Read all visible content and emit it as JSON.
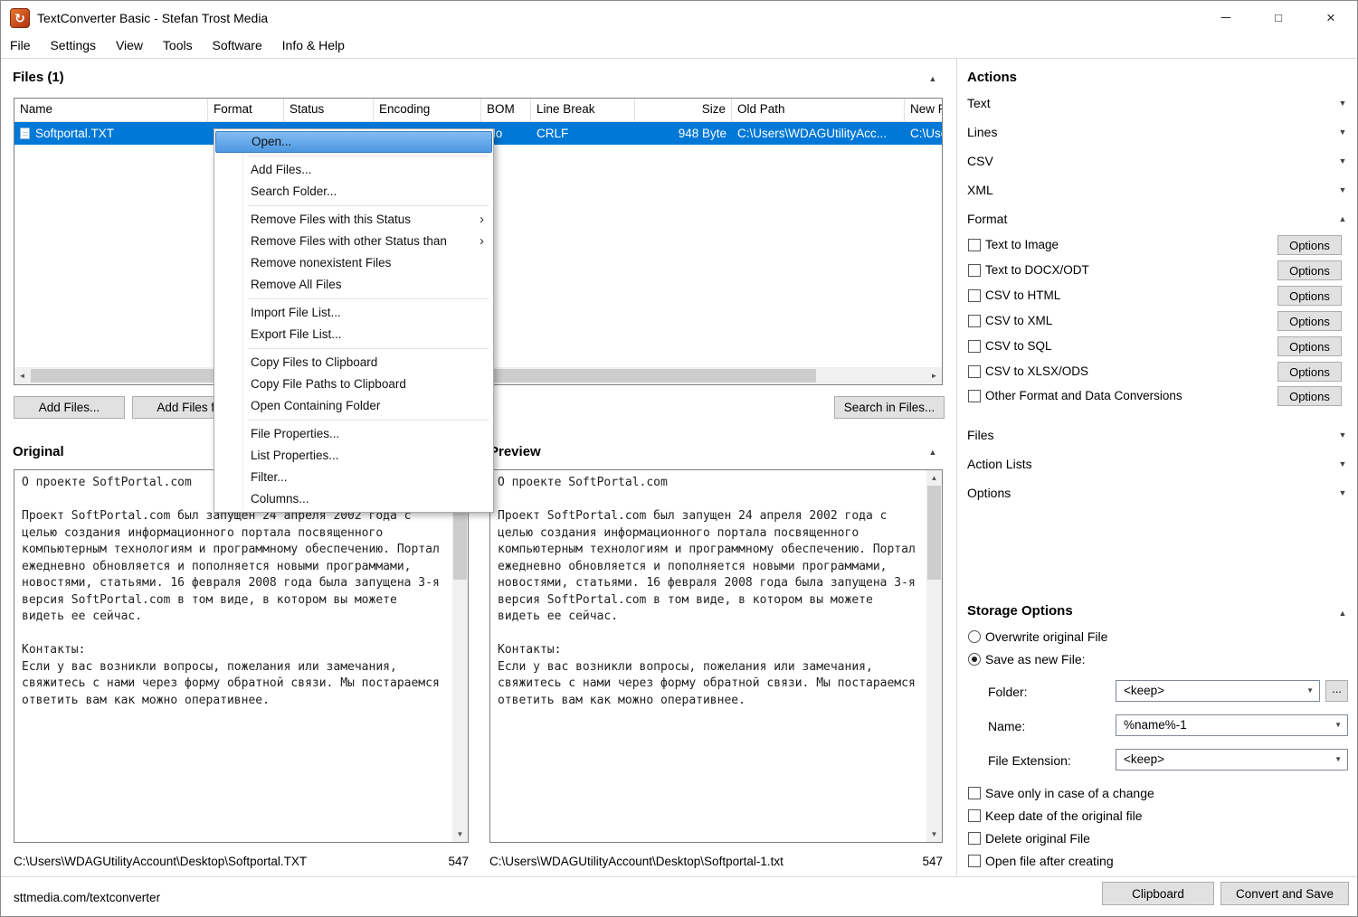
{
  "icons": {
    "app": "↻",
    "minimize": "─",
    "maximize": "□",
    "close": "×",
    "chevron_down": "▼",
    "chevron_up": "▲",
    "submenu_arrow": "›",
    "scroll_left": "◄",
    "scroll_right": "►",
    "scroll_up": "▲",
    "scroll_down": "▼",
    "combo_arrow": "▼"
  },
  "titlebar": {
    "title": "TextConverter Basic - Stefan Trost Media"
  },
  "menubar": {
    "items": [
      "File",
      "Settings",
      "View",
      "Tools",
      "Software",
      "Info & Help"
    ]
  },
  "files_panel": {
    "title": "Files (1)",
    "columns": [
      "Name",
      "Format",
      "Status",
      "Encoding",
      "BOM",
      "Line Break",
      "Size",
      "Old Path",
      "New P"
    ],
    "row": {
      "name": "Softportal.TXT",
      "format": "",
      "status": "",
      "encoding": "",
      "bom": "No",
      "line_break": "CRLF",
      "size": "948 Byte",
      "old_path": "C:\\Users\\WDAGUtilityAcc...",
      "new_path": "C:\\Use..."
    },
    "buttons": {
      "add_files": "Add Files...",
      "add_files_from": "Add Files fr",
      "search_in_files": "Search in Files..."
    }
  },
  "context_menu": {
    "items": [
      {
        "label": "Open..."
      },
      {
        "label": "Add Files..."
      },
      {
        "label": "Search Folder..."
      },
      {
        "label": "Remove Files with this Status"
      },
      {
        "label": "Remove Files with other Status than"
      },
      {
        "label": "Remove nonexistent Files"
      },
      {
        "label": "Remove All Files"
      },
      {
        "label": "Import File List..."
      },
      {
        "label": "Export File List..."
      },
      {
        "label": "Copy Files to Clipboard"
      },
      {
        "label": "Copy File Paths to Clipboard"
      },
      {
        "label": "Open Containing Folder"
      },
      {
        "label": "File Properties..."
      },
      {
        "label": "List Properties..."
      },
      {
        "label": "Filter..."
      },
      {
        "label": "Columns..."
      }
    ]
  },
  "original": {
    "title": "Original",
    "text": "О проекте SoftPortal.com\n\nПроект SoftPortal.com был запущен 24 апреля 2002 года с\nцелью создания информационного портала посвященного\nкомпьютерным технологиям и программному обеспечению. Портал\nежедневно обновляется и пополняется новыми программами,\nновостями, статьями. 16 февраля 2008 года была запущена 3-я\nверсия SoftPortal.com в том виде, в котором вы можете\nвидеть ее сейчас.\n\nКонтакты:\nЕсли у вас возникли вопросы, пожелания или замечания,\nсвяжитесь с нами через форму обратной связи. Мы постараемся\nответить вам как можно оперативнее.",
    "path": "C:\\Users\\WDAGUtilityAccount\\Desktop\\Softportal.TXT",
    "count": "547"
  },
  "preview": {
    "title": "Preview",
    "path": "C:\\Users\\WDAGUtilityAccount\\Desktop\\Softportal-1.txt",
    "count": "547"
  },
  "actions_panel": {
    "title": "Actions",
    "sections": [
      {
        "label": "Text"
      },
      {
        "label": "Lines"
      },
      {
        "label": "CSV"
      },
      {
        "label": "XML"
      },
      {
        "label": "Format"
      },
      {
        "label": "Files"
      },
      {
        "label": "Action Lists"
      },
      {
        "label": "Options"
      }
    ],
    "format_items": [
      {
        "label": "Text to Image"
      },
      {
        "label": "Text to DOCX/ODT"
      },
      {
        "label": "CSV to HTML"
      },
      {
        "label": "CSV to XML"
      },
      {
        "label": "CSV to SQL"
      },
      {
        "label": "CSV to XLSX/ODS"
      },
      {
        "label": "Other Format and Data Conversions"
      }
    ],
    "options_label": "Options"
  },
  "storage_options": {
    "title": "Storage Options",
    "overwrite_label": "Overwrite original File",
    "save_as_new_label": "Save as new File:",
    "folder_label": "Folder:",
    "folder_value": "<keep>",
    "browse_label": "...",
    "name_label": "Name:",
    "name_value": "%name%-1",
    "extension_label": "File Extension:",
    "extension_value": "<keep>",
    "checkboxes": [
      {
        "label": "Save only in case of a change"
      },
      {
        "label": "Keep date of the original file"
      },
      {
        "label": "Delete original File"
      },
      {
        "label": "Open file after creating"
      }
    ]
  },
  "footer": {
    "status": "sttmedia.com/textconverter",
    "clipboard_label": "Clipboard",
    "convert_label": "Convert and Save"
  }
}
